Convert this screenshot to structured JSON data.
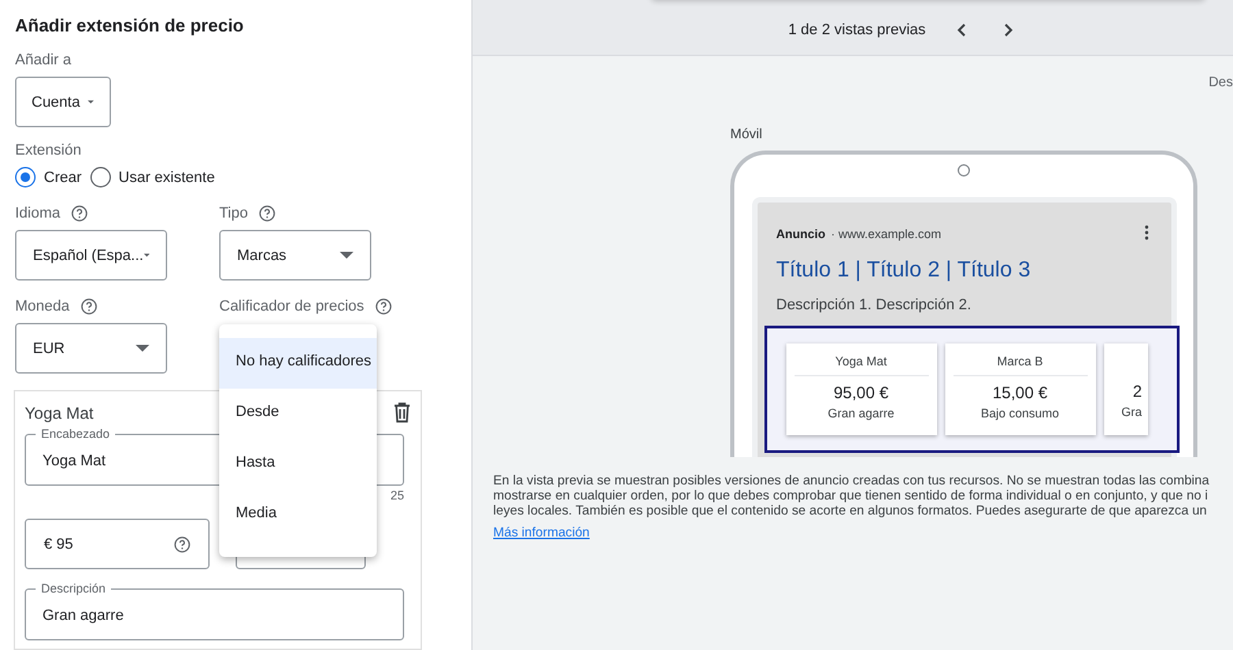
{
  "form": {
    "title": "Añadir extensión de precio",
    "add_to": {
      "label": "Añadir a",
      "value": "Cuenta"
    },
    "extension": {
      "label": "Extensión",
      "options": [
        {
          "label": "Crear",
          "selected": true
        },
        {
          "label": "Usar existente",
          "selected": false
        }
      ]
    },
    "language": {
      "label": "Idioma",
      "value": "Español (Espa..."
    },
    "type": {
      "label": "Tipo",
      "value": "Marcas"
    },
    "currency": {
      "label": "Moneda",
      "value": "EUR"
    },
    "qualifier": {
      "label": "Calificador de precios",
      "options": [
        {
          "label": "No hay calificadores",
          "selected": true
        },
        {
          "label": "Desde",
          "selected": false
        },
        {
          "label": "Hasta",
          "selected": false
        },
        {
          "label": "Media",
          "selected": false
        }
      ]
    },
    "item": {
      "title": "Yoga Mat",
      "header": {
        "label": "Encabezado",
        "value": "Yoga Mat",
        "counter": "25"
      },
      "price": {
        "value": "€ 95"
      },
      "description": {
        "label": "Descripción",
        "value": "Gran agarre"
      }
    }
  },
  "preview": {
    "pager": "1 de 2 vistas previas",
    "side_label": "Des",
    "device_label": "Móvil",
    "ad": {
      "badge": "Anuncio",
      "url": "· www.example.com",
      "headline": "Título 1 | Título 2 | Título 3",
      "description": "Descripción 1. Descripción 2.",
      "price_cards": [
        {
          "header": "Yoga Mat",
          "price": "95,00 €",
          "description": "Gran agarre"
        },
        {
          "header": "Marca B",
          "price": "15,00 €",
          "description": "Bajo consumo"
        },
        {
          "price": "2",
          "description": "Gra"
        }
      ]
    },
    "note": [
      "En la vista previa se muestran posibles versiones de anuncio creadas con tus recursos. No se muestran todas las combina",
      "mostrarse en cualquier orden, por lo que debes comprobar que tienen sentido de forma individual o en conjunto, y que no i",
      "leyes locales. También es posible que el contenido se acorte en algunos formatos. Puedes asegurarte de que aparezca un"
    ],
    "link": "Más información"
  }
}
